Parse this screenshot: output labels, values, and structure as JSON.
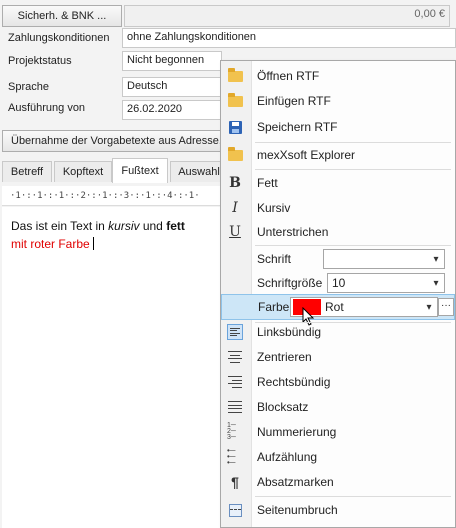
{
  "form": {
    "save_bnk_label": "Sicherh. & BNK ...",
    "amount": "0,00 €",
    "payment_terms_label": "Zahlungskonditionen",
    "payment_terms_value": "ohne Zahlungskonditionen",
    "project_status_label": "Projektstatus",
    "project_status_value": "Nicht begonnen",
    "language_label": "Sprache",
    "language_value": "Deutsch",
    "execution_label": "Ausführung von",
    "execution_value": "26.02.2020",
    "adopt_texts_label": "Übernahme der Vorgabetexte aus Adresse,"
  },
  "tabs": [
    "Betreff",
    "Kopftext",
    "Fußtext",
    "Auswahl"
  ],
  "active_tab": "Fußtext",
  "ruler": "·1·:·1·:·1·:·2·:·1·:·3·:·1·:·4·:·1·",
  "editor": {
    "line1_a": "Das ist ein Text in ",
    "line1_italic": "kursiv",
    "line1_b": " und ",
    "line1_bold": "fett",
    "line2": "mit roter Farbe",
    "red_color": "#e00000"
  },
  "menu": {
    "open_rtf": "Öffnen RTF",
    "insert_rtf": "Einfügen RTF",
    "save_rtf": "Speichern RTF",
    "explorer": "mexXsoft Explorer",
    "bold": "Fett",
    "italic": "Kursiv",
    "underline": "Unterstrichen",
    "font_label": "Schrift",
    "font_value": "",
    "size_label": "Schriftgröße",
    "size_value": "10",
    "color_label": "Farbe",
    "color_value": "Rot",
    "color_swatch": "#ff0000",
    "align_left": "Linksbündig",
    "center": "Zentrieren",
    "align_right": "Rechtsbündig",
    "justify": "Blocksatz",
    "numbering": "Nummerierung",
    "bullets": "Aufzählung",
    "paragraph_marks": "Absatzmarken",
    "page_break": "Seitenumbruch"
  }
}
